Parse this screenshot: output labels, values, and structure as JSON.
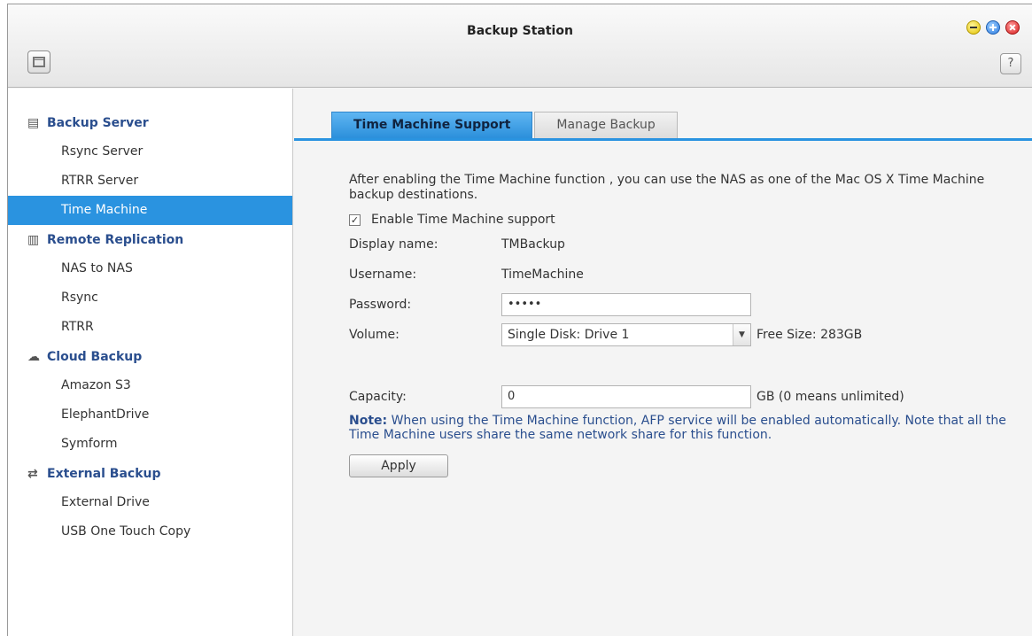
{
  "window": {
    "title": "Backup Station",
    "help_label": "?"
  },
  "sidebar": {
    "groups": [
      {
        "label": "Backup Server",
        "icon": "server-icon",
        "items": [
          "Rsync Server",
          "RTRR Server",
          "Time Machine"
        ]
      },
      {
        "label": "Remote Replication",
        "icon": "replication-icon",
        "items": [
          "NAS to NAS",
          "Rsync",
          "RTRR"
        ]
      },
      {
        "label": "Cloud Backup",
        "icon": "cloud-icon",
        "items": [
          "Amazon S3",
          "ElephantDrive",
          "Symform"
        ]
      },
      {
        "label": "External Backup",
        "icon": "sync-icon",
        "items": [
          "External Drive",
          "USB One Touch Copy"
        ]
      }
    ],
    "active_item": "Time Machine"
  },
  "tabs": {
    "active": "Time Machine Support",
    "inactive": "Manage Backup"
  },
  "form": {
    "description": "After enabling the Time Machine function , you can use the NAS as one of the Mac OS X Time Machine backup destinations.",
    "enable_label": "Enable Time Machine support",
    "enable_checked": true,
    "display_name_label": "Display name:",
    "display_name_value": "TMBackup",
    "username_label": "Username:",
    "username_value": "TimeMachine",
    "password_label": "Password:",
    "password_value": "•••••",
    "volume_label": "Volume:",
    "volume_value": "Single Disk: Drive  1",
    "free_size": "Free Size: 283GB",
    "capacity_label": "Capacity:",
    "capacity_value": "0",
    "capacity_unit": "GB (0 means unlimited)",
    "note_prefix": "Note:",
    "note_text": " When using the Time Machine function, AFP service will be enabled automatically. Note that all the Time Machine users share the same network share for this function.",
    "apply_label": "Apply"
  },
  "colors": {
    "accent": "#2a93e0",
    "link_blue": "#2a4e8e"
  }
}
